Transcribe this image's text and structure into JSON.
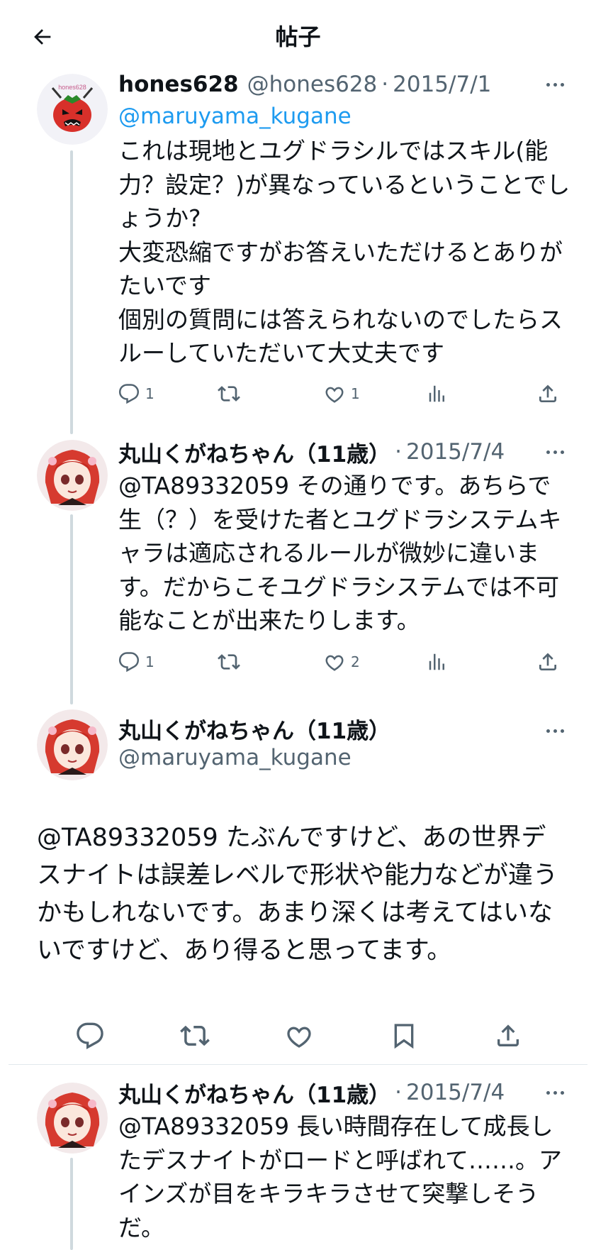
{
  "header": {
    "title": "帖子"
  },
  "tweets": [
    {
      "name": "hones628",
      "handle": "@hones628",
      "dot": "·",
      "date": "2015/7/1",
      "mention": "@maruyama_kugane",
      "text": "これは現地とユグドラシルではスキル(能力？設定？)が異なっているということでしょうか?\n大変恐縮ですがお答えいただけるとありがたいです\n個別の質問には答えられないのでしたらスルーしていただいて大丈夫です",
      "replies": "1",
      "likes": "1",
      "avatar_label": "hones628"
    },
    {
      "name": "丸山くがねちゃん（11歳）",
      "dot": "·",
      "date": "2015/7/4",
      "text": "@TA89332059 その通りです。あちらで生（？）を受けた者とユグドラシステムキャラは適応されるルールが微妙に違います。だからこそユグドラシステムでは不可能なことが出来たりします。",
      "replies": "1",
      "likes": "2"
    }
  ],
  "main_tweet": {
    "name": "丸山くがねちゃん（11歳）",
    "handle": "@maruyama_kugane",
    "text": "@TA89332059 たぶんですけど、あの世界デスナイトは誤差レベルで形状や能力などが違うかもしれないです。あまり深くは考えてはいないですけど、あり得ると思ってます。"
  },
  "reply_tweet": {
    "name": "丸山くがねちゃん（11歳）",
    "dot": "·",
    "date": "2015/7/4",
    "text": "@TA89332059 長い時間存在して成長したデスナイトがロードと呼ばれて……。アインズが目をキラキラさせて突撃しそうだ。"
  },
  "colors": {
    "accent": "#1d9bf0",
    "secondary_text": "#536471",
    "thread_line": "#cfd9de",
    "avatar_red": "#d8302a"
  },
  "icons": [
    "back-arrow-icon",
    "more-icon",
    "reply-icon",
    "retweet-icon",
    "like-icon",
    "views-icon",
    "share-icon",
    "bookmark-icon"
  ]
}
